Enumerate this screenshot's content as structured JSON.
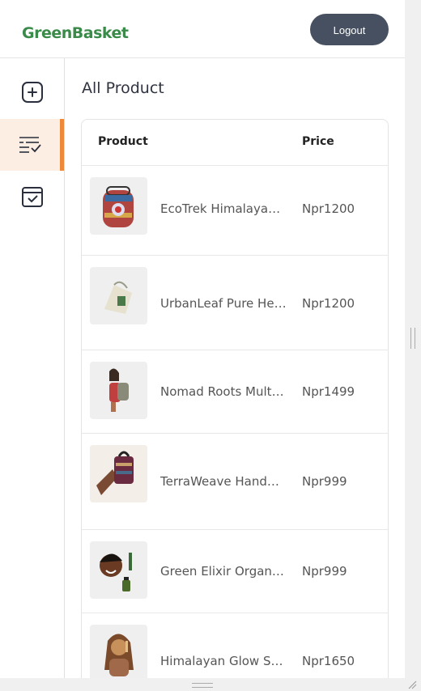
{
  "header": {
    "logo": "GreenBasket",
    "logout_label": "Logout"
  },
  "sidebar": {
    "items": [
      {
        "icon": "add-square-icon",
        "active": false
      },
      {
        "icon": "list-check-icon",
        "active": true
      },
      {
        "icon": "calendar-check-icon",
        "active": false
      }
    ]
  },
  "main": {
    "title": "All Product",
    "table": {
      "columns": [
        "Product",
        "Price"
      ],
      "rows": [
        {
          "name": "EcoTrek Himalayan Backpack",
          "price": "Npr1200",
          "thumb": "backpack-image"
        },
        {
          "name": "UrbanLeaf Pure Hemp Bag",
          "price": "Npr1200",
          "thumb": "hemp-bag-image"
        },
        {
          "name": "Nomad Roots Multicolor Bag",
          "price": "Npr1499",
          "thumb": "model-backpack-image"
        },
        {
          "name": "TerraWeave Handwoven Bag",
          "price": "Npr999",
          "thumb": "woven-bag-image"
        },
        {
          "name": "Green Elixir Organic Oil",
          "price": "Npr999",
          "thumb": "elixir-oil-image"
        },
        {
          "name": "Himalayan Glow Serum",
          "price": "Npr1650",
          "thumb": "glow-serum-image"
        }
      ]
    }
  },
  "colors": {
    "brand": "#3a8a4a",
    "active_accent": "#f0883a",
    "active_bg": "#fdeee3",
    "logout_bg": "#465060"
  }
}
